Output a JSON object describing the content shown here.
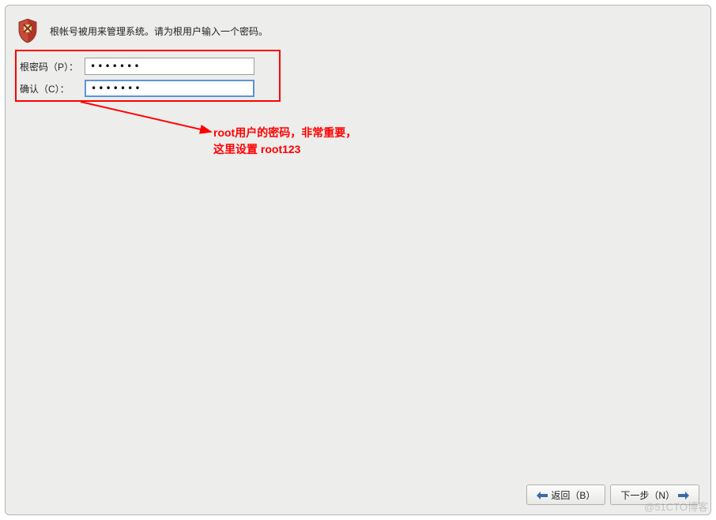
{
  "header": {
    "instruction": "根帐号被用来管理系统。请为根用户输入一个密码。",
    "icon": "shield-icon"
  },
  "form": {
    "password_label": "根密码（P）：",
    "password_value": "•••••••",
    "confirm_label": "确认（C）：",
    "confirm_value": "•••••••"
  },
  "annotation": {
    "line1": "root用户的密码，非常重要，",
    "line2": "这里设置 root123"
  },
  "footer": {
    "back_label": "返回（B）",
    "next_label": "下一步（N）"
  },
  "watermark": "@51CTO博客"
}
